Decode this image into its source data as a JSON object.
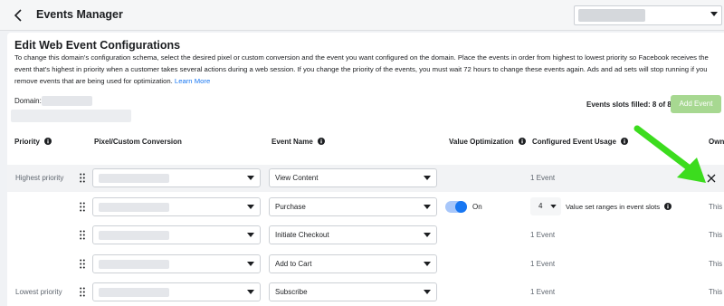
{
  "topbar": {
    "title": "Events Manager"
  },
  "page": {
    "heading": "Edit Web Event Configurations",
    "description": "To change this domain's configuration schema, select the desired pixel or custom conversion and the event you want configured on the domain. Place the events in order from highest to lowest priority so Facebook receives the event that's highest in priority when a customer takes several actions during a web session. If you change the priority of the events, you must wait 72 hours to change these events again. Ads and ad sets will stop running if you remove events that are being used for optimization.",
    "learn_more": "Learn More",
    "domain_label": "Domain:",
    "slots_text": "Events slots filled: 8 of 8",
    "add_event_label": "Add Event"
  },
  "columns": {
    "priority": "Priority",
    "pixel": "Pixel/Custom Conversion",
    "event_name": "Event Name",
    "value_opt": "Value Optimization",
    "usage": "Configured Event Usage",
    "owner": "Own"
  },
  "rows": [
    {
      "priority": "Highest priority",
      "event": "View Content",
      "usage": "1 Event",
      "value_opt": "",
      "trailing": ""
    },
    {
      "priority": "",
      "event": "Purchase",
      "usage": "",
      "value_opt": "On",
      "value_count": "4",
      "value_text": "Value set ranges in event slots",
      "trailing": "This"
    },
    {
      "priority": "",
      "event": "Initiate Checkout",
      "usage": "1 Event",
      "value_opt": "",
      "trailing": "This"
    },
    {
      "priority": "",
      "event": "Add to Cart",
      "usage": "1 Event",
      "value_opt": "",
      "trailing": "This"
    },
    {
      "priority": "Lowest priority",
      "event": "Subscribe",
      "usage": "1 Event",
      "value_opt": "",
      "trailing": "This"
    }
  ],
  "colors": {
    "accent": "#1877f2",
    "arrow": "#3cdc1e",
    "add_button": "#a7d891"
  },
  "icons": [
    "back-icon",
    "info-icon",
    "drag-handle-icon",
    "chevron-down-icon",
    "close-icon",
    "green-arrow"
  ]
}
